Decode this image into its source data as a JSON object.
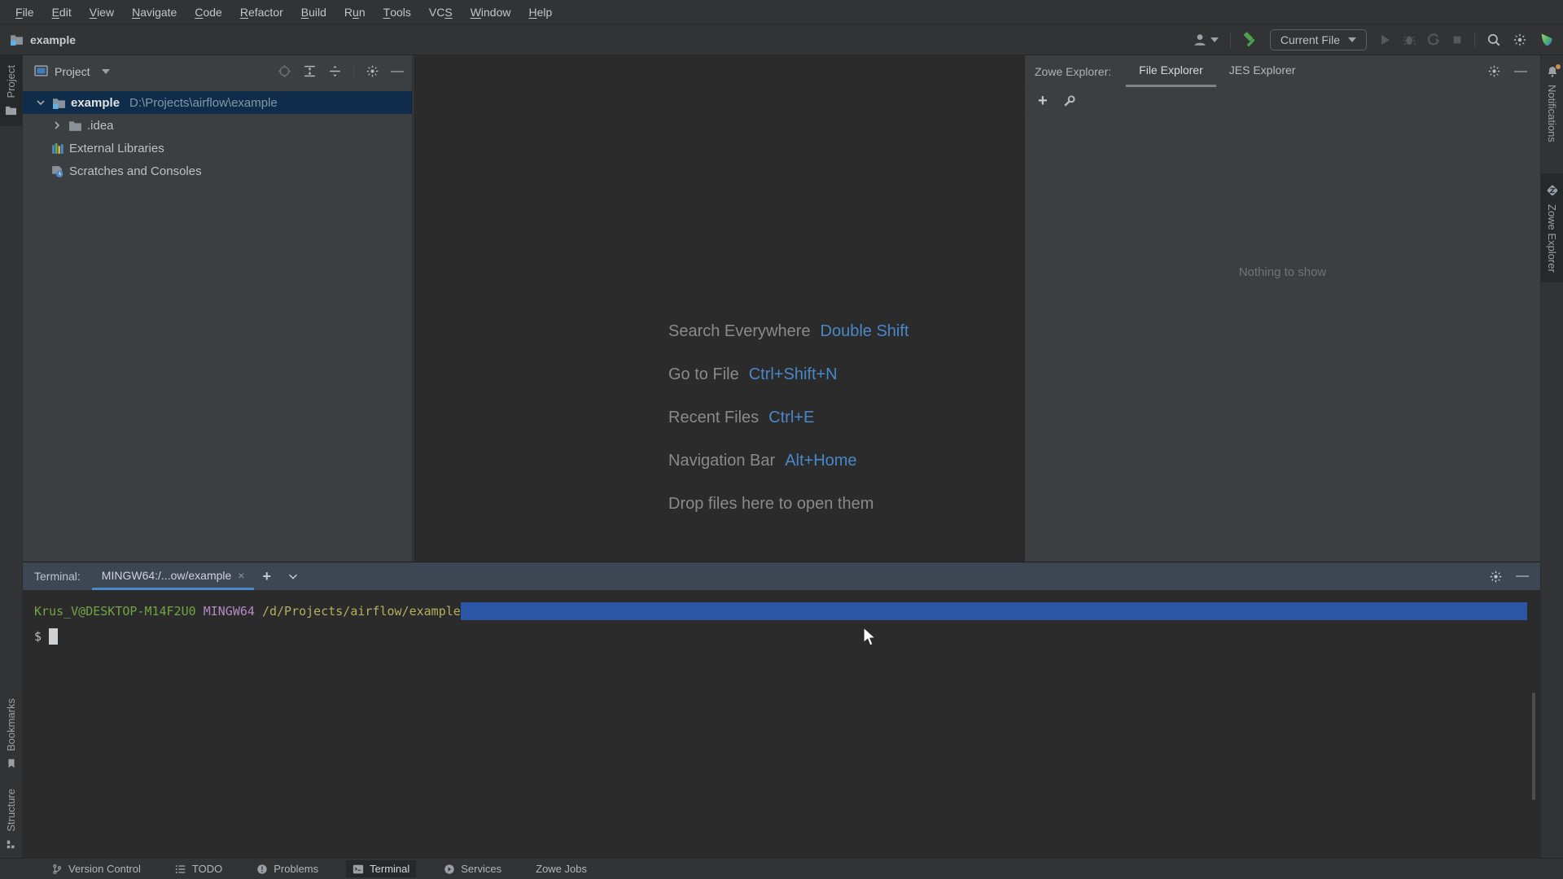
{
  "menubar": {
    "items": [
      {
        "pre": "",
        "mn": "F",
        "post": "ile"
      },
      {
        "pre": "",
        "mn": "E",
        "post": "dit"
      },
      {
        "pre": "",
        "mn": "V",
        "post": "iew"
      },
      {
        "pre": "",
        "mn": "N",
        "post": "avigate"
      },
      {
        "pre": "",
        "mn": "C",
        "post": "ode"
      },
      {
        "pre": "",
        "mn": "R",
        "post": "efactor"
      },
      {
        "pre": "",
        "mn": "B",
        "post": "uild"
      },
      {
        "pre": "R",
        "mn": "u",
        "post": "n"
      },
      {
        "pre": "",
        "mn": "T",
        "post": "ools"
      },
      {
        "pre": "VC",
        "mn": "S",
        "post": ""
      },
      {
        "pre": "",
        "mn": "W",
        "post": "indow"
      },
      {
        "pre": "",
        "mn": "H",
        "post": "elp"
      }
    ]
  },
  "toolbar": {
    "project_name": "example",
    "current_file": "Current File"
  },
  "left_strip": {
    "top": [
      {
        "label": "Project"
      }
    ],
    "bottom": [
      {
        "label": "Bookmarks"
      },
      {
        "label": "Structure"
      }
    ]
  },
  "project_panel": {
    "title": "Project",
    "tree": [
      {
        "name": "example",
        "path": "D:\\Projects\\airflow\\example"
      },
      {
        "name": ".idea"
      },
      {
        "name": "External Libraries"
      },
      {
        "name": "Scratches and Consoles"
      }
    ]
  },
  "editor": {
    "shortcuts": [
      {
        "label": "Search Everywhere",
        "keys": "Double Shift"
      },
      {
        "label": "Go to File",
        "keys": "Ctrl+Shift+N"
      },
      {
        "label": "Recent Files",
        "keys": "Ctrl+E"
      },
      {
        "label": "Navigation Bar",
        "keys": "Alt+Home"
      }
    ],
    "drop_hint": "Drop files here to open them"
  },
  "zowe_panel": {
    "title": "Zowe Explorer:",
    "tabs": [
      {
        "label": "File Explorer"
      },
      {
        "label": "JES Explorer"
      }
    ],
    "empty_text": "Nothing to show"
  },
  "right_strip": {
    "items": [
      {
        "label": "Notifications"
      },
      {
        "label": "Zowe Explorer"
      }
    ]
  },
  "terminal": {
    "label": "Terminal:",
    "tab": "MINGW64:/...ow/example",
    "close": "×",
    "prompt": {
      "user": "Krus_V@DESKTOP-M14F2U0",
      "env": "MINGW64",
      "path": "/d/Projects/airflow/example"
    },
    "prompt_symbol": "$"
  },
  "status_bar": {
    "items": [
      {
        "label": "Version Control"
      },
      {
        "label": "TODO"
      },
      {
        "label": "Problems"
      },
      {
        "label": "Terminal"
      },
      {
        "label": "Services"
      },
      {
        "label": "Zowe Jobs"
      }
    ]
  },
  "colors": {
    "accent_blue": "#4987c8",
    "selection_blue": "#2a56a5",
    "tree_selection": "#0f2d4b",
    "terminal_green": "#72a344",
    "terminal_purple": "#b389c5",
    "terminal_yellow": "#b3af5f",
    "hammer_green": "#4ea04e",
    "notification_dot": "#cf8e46"
  }
}
